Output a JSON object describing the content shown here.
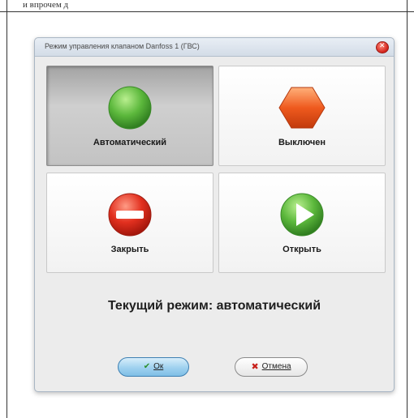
{
  "document": {
    "top_text": "и впрочем д"
  },
  "dialog": {
    "title": "Режим управления клапаном Danfoss 1 (ГВС)",
    "tiles": [
      {
        "label": "Автоматический",
        "icon": "green-circle-icon",
        "active": true
      },
      {
        "label": "Выключен",
        "icon": "orange-hexagon-icon",
        "active": false
      },
      {
        "label": "Закрыть",
        "icon": "red-minus-circle-icon",
        "active": false
      },
      {
        "label": "Открыть",
        "icon": "green-play-circle-icon",
        "active": false
      }
    ],
    "status_text": "Текущий режим: автоматический",
    "buttons": {
      "ok_label": "Ок",
      "cancel_label": "Отмена"
    }
  },
  "colors": {
    "green": "#5cb83c",
    "orange": "#ef5a1e",
    "red": "#e2301f",
    "accent_blue": "#9fd1ef"
  }
}
